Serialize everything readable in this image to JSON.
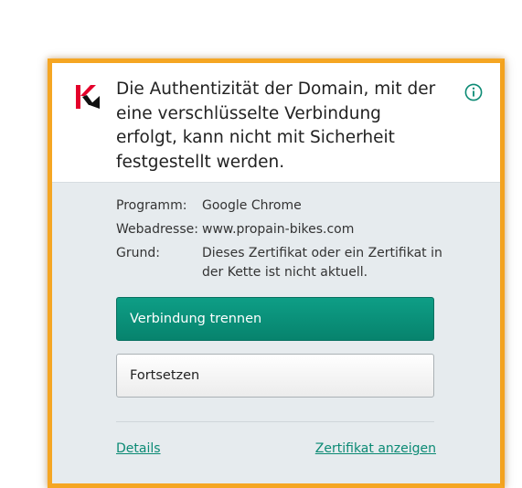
{
  "dialog": {
    "title": "Die Authentizität der Domain, mit der eine verschlüsselte Verbindung erfolgt, kann nicht mit Sicherheit festgestellt werden.",
    "logo_icon": "kaspersky-logo-icon",
    "info_icon": "info-icon",
    "fields": [
      {
        "label": "Programm:",
        "value": "Google Chrome"
      },
      {
        "label": "Webadresse:",
        "value": "www.propain-bikes.com"
      },
      {
        "label": "Grund:",
        "value": "Dieses Zertifikat oder ein Zertifikat in der Kette ist nicht aktuell."
      }
    ],
    "primary_button": "Verbindung trennen",
    "secondary_button": "Fortsetzen",
    "details_link": "Details",
    "certificate_link": "Zertifikat anzeigen"
  },
  "colors": {
    "frame": "#f5a623",
    "accent": "#0b8a74",
    "primary_button": "#0a927b",
    "body_background": "#e6ebee"
  }
}
